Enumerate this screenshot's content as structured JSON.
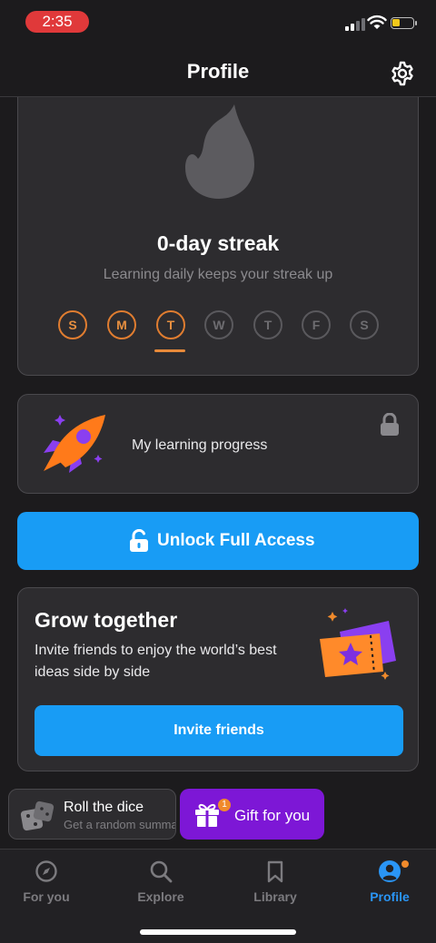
{
  "status_bar": {
    "time": "2:35"
  },
  "header": {
    "title": "Profile"
  },
  "streak": {
    "title": "0-day streak",
    "subtitle": "Learning daily keeps your streak up",
    "days": [
      "S",
      "M",
      "T",
      "W",
      "T",
      "F",
      "S"
    ]
  },
  "progress_card": {
    "label": "My learning progress"
  },
  "unlock": {
    "label": "Unlock Full Access"
  },
  "grow": {
    "title": "Grow together",
    "text": "Invite friends to enjoy the world’s best ideas side by side",
    "button": "Invite friends"
  },
  "chips": {
    "dice_title": "Roll the dice",
    "dice_sub": "Get a random summary",
    "gift_label": "Gift for you",
    "gift_badge": "1"
  },
  "tabs": [
    {
      "label": "For you"
    },
    {
      "label": "Explore"
    },
    {
      "label": "Library"
    },
    {
      "label": "Profile"
    }
  ],
  "colors": {
    "accent": "#189cf5",
    "streak": "#e07d30",
    "gift": "#7d17d6"
  }
}
